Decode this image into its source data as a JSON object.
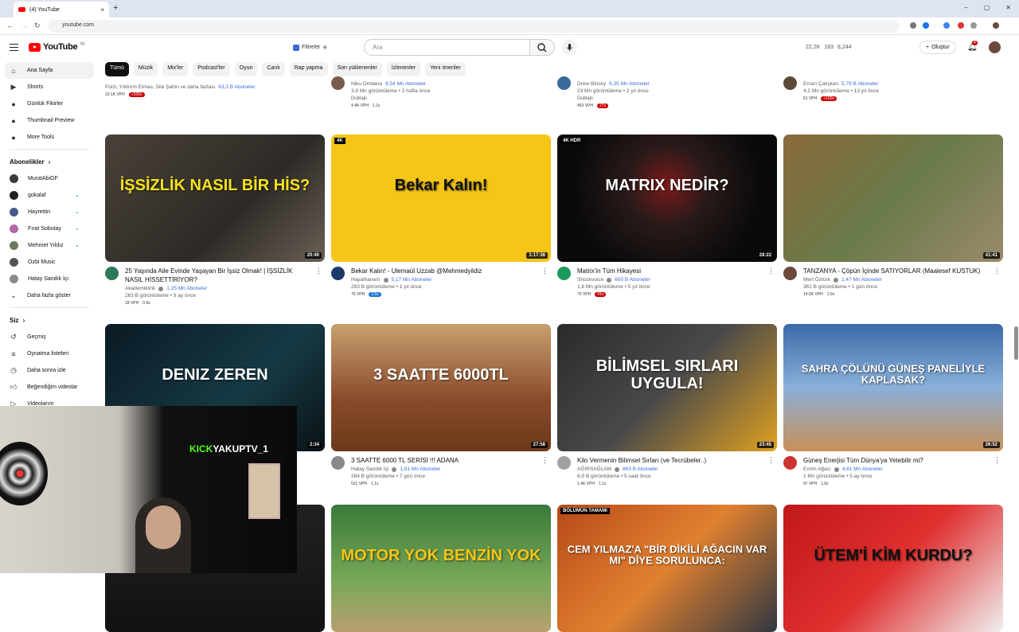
{
  "browser": {
    "tab_title": "(4) YouTube",
    "url": "youtube.com",
    "new_tab": "+",
    "tab_close": "×"
  },
  "header": {
    "logo_text": "YouTube",
    "logo_sup": "TR",
    "filter_label": "Filtreler",
    "search_placeholder": "Ara",
    "stats": [
      "22.2K",
      "183",
      "8,244"
    ],
    "create_label": "Oluştur",
    "notification_count": "4"
  },
  "chips": [
    "Tümü",
    "Müzik",
    "Mix'ler",
    "Podcast'ler",
    "Oyun",
    "Canlı",
    "Rap yapma",
    "Son yüklenenler",
    "İzlenenler",
    "Yeni öneriler"
  ],
  "sidebar": {
    "main": [
      {
        "label": "Ana Sayfa",
        "icon": "home-icon"
      },
      {
        "label": "Shorts",
        "icon": "shorts-icon"
      },
      {
        "label": "Günlük Fikirler",
        "icon": "circle-icon"
      },
      {
        "label": "Thumbnail Preview",
        "icon": "circle-icon"
      },
      {
        "label": "More Tools",
        "icon": "circle-icon"
      }
    ],
    "subs_header": "Abonelikler",
    "subs": [
      {
        "label": "MuratAbiGF",
        "color": "#3a3a3a",
        "dot": false
      },
      {
        "label": "gokalaf",
        "color": "#222222",
        "dot": true
      },
      {
        "label": "Hayrettin",
        "color": "#4a5a8a",
        "dot": true
      },
      {
        "label": "Fırat Sobutay",
        "color": "#b06aa8",
        "dot": true
      },
      {
        "label": "Mehmet Yıldız",
        "color": "#6a7a5a",
        "dot": true
      },
      {
        "label": "Ozbi Music",
        "color": "#555555",
        "dot": false
      },
      {
        "label": "Hatay Sandık İçi",
        "color": "#8a8a8a",
        "dot": false
      }
    ],
    "more_label": "Daha fazla göster",
    "you_header": "Siz",
    "you": [
      {
        "label": "Geçmiş",
        "icon": "history-icon"
      },
      {
        "label": "Oynatma listeleri",
        "icon": "playlist-icon"
      },
      {
        "label": "Daha sonra izle",
        "icon": "clock-icon"
      },
      {
        "label": "Beğendiğim videolar",
        "icon": "thumbs-up-icon"
      },
      {
        "label": "Videolarım",
        "icon": "video-icon"
      }
    ]
  },
  "top_partial": [
    {
      "line1": "Poizi, Yıldırım Elmas, Sila Şahin ve daha fazlası",
      "subs": "63,3 B Aboneler",
      "pills": [
        "10.1K VPH",
        "+100x"
      ]
    },
    {
      "line1": "Niko Omilana",
      "subs": "8,54 Mn Aboneler",
      "views": "3,9 Mn görüntüleme • 2 hafta önce",
      "tag": "Dublajlı",
      "pills": [
        "4.4K VPH",
        "1.1x"
      ]
    },
    {
      "line1": "Drew Binsky",
      "subs": "6,35 Mn Aboneler",
      "views": "23 Mn görüntüleme • 2 yıl önce",
      "tag": "Dublajlı",
      "pills": [
        "463 VPH",
        "27x"
      ]
    },
    {
      "line1": "Ercan Çalışkan",
      "subs": "5,79 B Aboneler",
      "views": "4,2 Mn görüntüleme • 13 yıl önce",
      "pills": [
        "61 VPH",
        "+100x"
      ]
    }
  ],
  "videos": [
    {
      "title": "25 Yaşında Aile Evinde Yaşayan Bir İşsiz Olmak! | İŞSİZLİK NASIL HİSSETTİRİYOR?",
      "channel": "Akademiklink",
      "subs": "1,25 Mn Aboneler",
      "views": "263 B görüntüleme • 9 ay önce",
      "duration": "20:40",
      "pills": [
        "18 VPH",
        "0.9x"
      ],
      "thumb_text": "İŞSİZLİK NASIL BİR HİS?"
    },
    {
      "title": "Bekar Kalın! - Ulemaül Uzzab @Mehmedyildiz",
      "channel": "Hayalhanem",
      "subs": "5,17 Mn Aboneler",
      "views": "263 B görüntüleme • 1 yıl önce",
      "duration": "1:17:36",
      "pills": [
        "75 VPH",
        "2.5x"
      ],
      "thumb_text": "Bekar Kalın!",
      "badge": "4K"
    },
    {
      "title": "Matrix'in Tüm Hikayesi",
      "channel": "Shockvoice",
      "subs": "600 B Aboneler",
      "views": "1,8 Mn görüntüleme • 5 yıl önce",
      "duration": "28:22",
      "pills": [
        "70 VPH",
        "41x"
      ],
      "thumb_text": "MATRIX NEDİR?",
      "badge": "4K HDR"
    },
    {
      "title": "TANZANYA - Çöpün İçinde SATIYORLAR (Maalesef KUSTUK)",
      "channel": "Mert Öztürk",
      "subs": "1,47 Mn Aboneler",
      "views": "361 B görüntüleme • 1 gün önce",
      "duration": "41:41",
      "pills": [
        "14.6K VPH",
        "1.9x"
      ],
      "thumb_text": ""
    },
    {
      "title": "",
      "channel": "",
      "subs": "",
      "views": "",
      "duration": "2:34",
      "pills": [],
      "thumb_text": "DENIZ ZEREN"
    },
    {
      "title": "3 SAATTE 6000 TL SERİSİ !!! ADANA",
      "channel": "Hatay Sandık İçi",
      "subs": "1,81 Mn Aboneler",
      "views": "284 B görüntüleme • 7 gün önce",
      "duration": "27:58",
      "pills": [
        "521 VPH",
        "1.1x"
      ],
      "thumb_text": "3 SAATTE 6000TL"
    },
    {
      "title": "Kilo Vermenin Bilimsel Sırları (ve Tecrübeler..)",
      "channel": "AĞIRSAĞLAM",
      "subs": "863 B Aboneler",
      "views": "6,9 B görüntüleme • 5 saat önce",
      "duration": "23:45",
      "pills": [
        "1.4K VPH",
        "1.1x"
      ],
      "thumb_text": "BİLİMSEL SIRLARI UYGULA!"
    },
    {
      "title": "Güneş Enerjisi Tüm Dünya'ya Yetebilir mi?",
      "channel": "Evrim Ağacı",
      "subs": "4,61 Mn Aboneler",
      "views": "1 Mn görüntüleme • 5 ay önce",
      "duration": "26:52",
      "pills": [
        "97 VPH",
        "1.6x"
      ],
      "thumb_text": "SAHRA ÇÖLÜNÜ GÜNEŞ PANELİYLE KAPLASAK?"
    },
    {
      "title": "",
      "channel": "",
      "subs": "",
      "views": "",
      "duration": "",
      "pills": [],
      "thumb_text": ""
    },
    {
      "title": "",
      "channel": "",
      "subs": "",
      "views": "",
      "duration": "",
      "pills": [],
      "thumb_text": "MOTOR YOK BENZİN YOK"
    },
    {
      "title": "",
      "channel": "",
      "subs": "",
      "views": "",
      "duration": "",
      "pills": [],
      "thumb_text": "CEM YILMAZ'A \"BİR DİKİLİ AĞACIN VAR MI\" DİYE SORULUNCA:",
      "badge": "BÖLÜMÜN TAMAMI"
    },
    {
      "title": "",
      "channel": "",
      "subs": "",
      "views": "",
      "duration": "",
      "pills": [],
      "thumb_text": "ÜTEM'İ KİM KURDU?"
    }
  ],
  "webcam": {
    "kick_prefix": "KICK",
    "kick_user": "YAKUPTV_1"
  }
}
